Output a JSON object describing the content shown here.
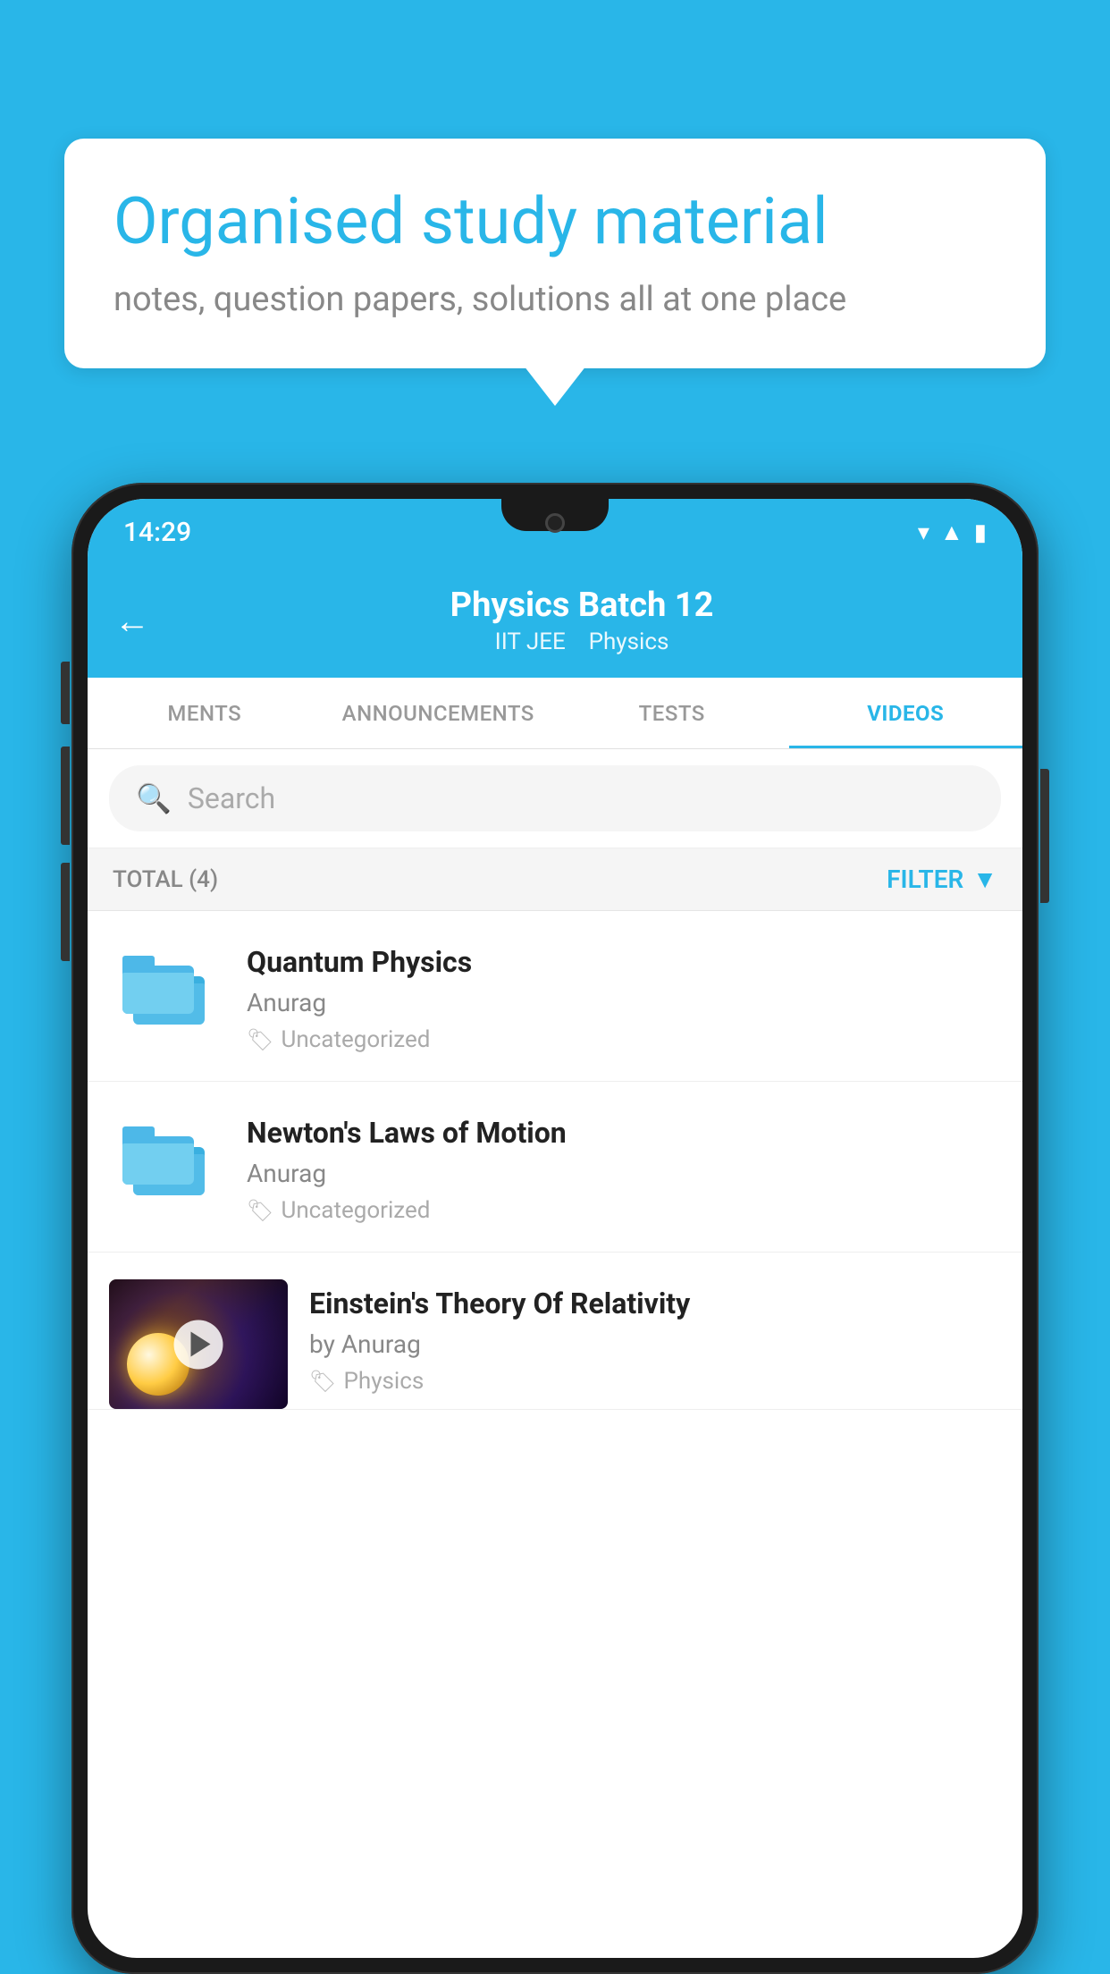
{
  "background_color": "#29b6e8",
  "speech_bubble": {
    "title": "Organised study material",
    "subtitle": "notes, question papers, solutions all at one place"
  },
  "status_bar": {
    "time": "14:29",
    "icons": [
      "wifi",
      "signal",
      "battery"
    ]
  },
  "app_header": {
    "title": "Physics Batch 12",
    "subtitle_part1": "IIT JEE",
    "subtitle_part2": "Physics",
    "back_label": "←"
  },
  "tabs": [
    {
      "label": "MENTS",
      "active": false
    },
    {
      "label": "ANNOUNCEMENTS",
      "active": false
    },
    {
      "label": "TESTS",
      "active": false
    },
    {
      "label": "VIDEOS",
      "active": true
    }
  ],
  "search": {
    "placeholder": "Search"
  },
  "filter_bar": {
    "total_label": "TOTAL (4)",
    "filter_label": "FILTER"
  },
  "videos": [
    {
      "id": 1,
      "title": "Quantum Physics",
      "author": "Anurag",
      "tag": "Uncategorized",
      "has_thumb": false
    },
    {
      "id": 2,
      "title": "Newton's Laws of Motion",
      "author": "Anurag",
      "tag": "Uncategorized",
      "has_thumb": false
    },
    {
      "id": 3,
      "title": "Einstein's Theory Of Relativity",
      "author": "by Anurag",
      "tag": "Physics",
      "has_thumb": true
    }
  ]
}
